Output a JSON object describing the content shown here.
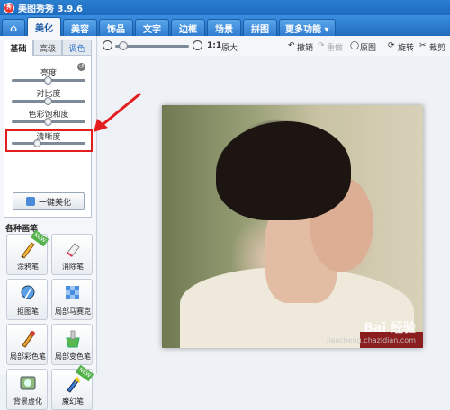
{
  "window": {
    "title": "美图秀秀 3.9.6",
    "logo_text": "秀"
  },
  "tabs": [
    {
      "label": "美化"
    },
    {
      "label": "美容"
    },
    {
      "label": "饰品"
    },
    {
      "label": "文字"
    },
    {
      "label": "边框"
    },
    {
      "label": "场景"
    },
    {
      "label": "拼图"
    },
    {
      "label": "更多功能 ▾"
    }
  ],
  "subtabs": {
    "basic": "基础",
    "advanced": "高级",
    "color": "调色"
  },
  "sliders": [
    {
      "label": "亮度",
      "value": 0.5
    },
    {
      "label": "对比度",
      "value": 0.5
    },
    {
      "label": "色彩饱和度",
      "value": 0.5
    },
    {
      "label": "清晰度",
      "value": 0.35
    }
  ],
  "beautify_button": "一键美化",
  "brushes": {
    "title": "各种画笔",
    "badge": "NEW",
    "items": [
      {
        "label": "涂鸦笔",
        "icon": "graffiti-pen-icon"
      },
      {
        "label": "消除笔",
        "icon": "eraser-pen-icon"
      },
      {
        "label": "抠图笔",
        "icon": "cutout-pen-icon"
      },
      {
        "label": "局部马赛克",
        "icon": "mosaic-icon"
      },
      {
        "label": "局部彩色笔",
        "icon": "color-brush-icon"
      },
      {
        "label": "局部变色笔",
        "icon": "recolor-brush-icon"
      },
      {
        "label": "背景虚化",
        "icon": "blur-background-icon"
      },
      {
        "label": "魔幻笔",
        "icon": "magic-pen-icon"
      }
    ]
  },
  "toolbar": {
    "zoom_ratio": "1:1",
    "original_size": "原大",
    "undo": "撤销",
    "redo": "重做",
    "original": "原图",
    "rotate": "旋转",
    "crop": "裁剪",
    "zoom_level": 0.05
  },
  "watermark": {
    "main": "Bai 经验",
    "sub": "jiaocheng.chazidian.com"
  },
  "colors": {
    "accent": "#2b7fd0",
    "highlight": "#e41e1e"
  }
}
